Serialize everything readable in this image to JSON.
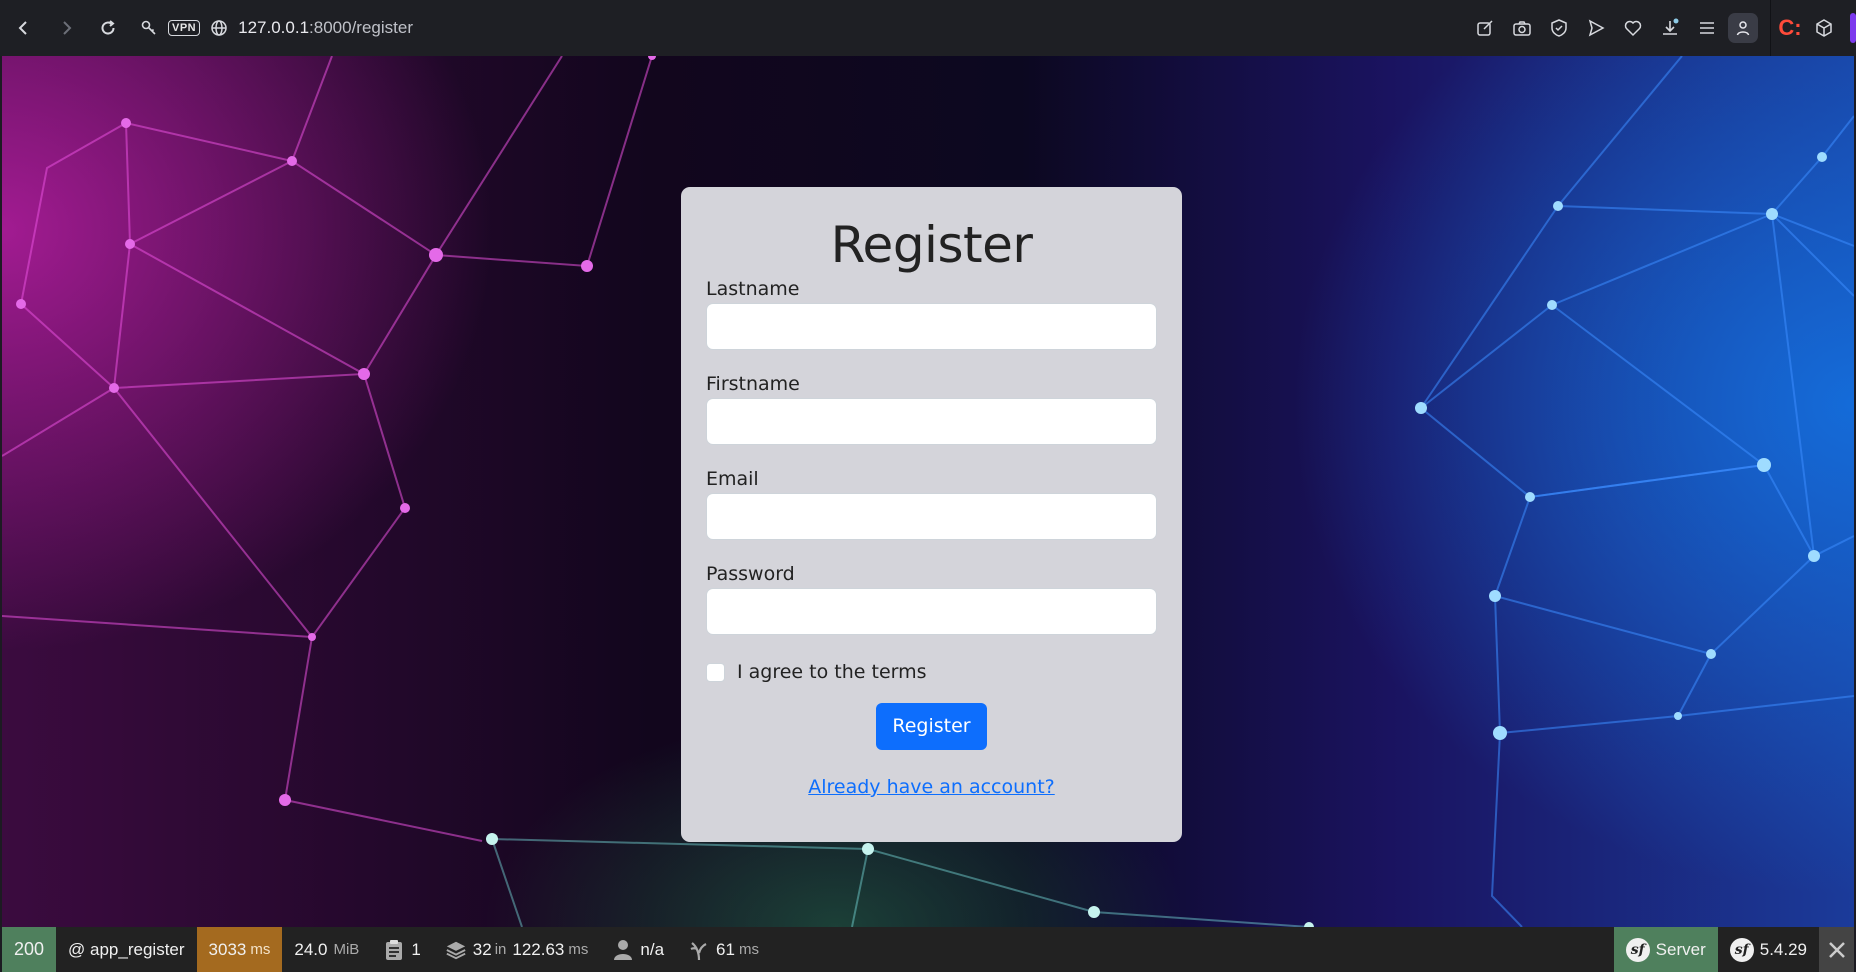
{
  "browser": {
    "vpn_label": "VPN",
    "url_host": "127.0.0.1",
    "url_path": ":8000/register"
  },
  "form": {
    "title": "Register",
    "fields": [
      {
        "label": "Lastname",
        "value": ""
      },
      {
        "label": "Firstname",
        "value": ""
      },
      {
        "label": "Email",
        "value": ""
      },
      {
        "label": "Password",
        "value": ""
      }
    ],
    "terms_label": "I agree to the terms",
    "submit_label": "Register",
    "login_link": "Already have an account?"
  },
  "toolbar": {
    "status": "200",
    "route": "@ app_register",
    "time_value": "3033",
    "time_unit": "ms",
    "memory_value": "24.0",
    "memory_unit": "MiB",
    "logs_count": "1",
    "cache_count": "32",
    "cache_in": "in",
    "cache_time": "122.63",
    "cache_unit": "ms",
    "user": "n/a",
    "twig_value": "61",
    "twig_unit": "ms",
    "server_label": "Server",
    "version": "5.4.29"
  },
  "colors": {
    "primary": "#0d6efd",
    "status_ok": "#4f805d",
    "time_warning": "#a46a1f"
  }
}
